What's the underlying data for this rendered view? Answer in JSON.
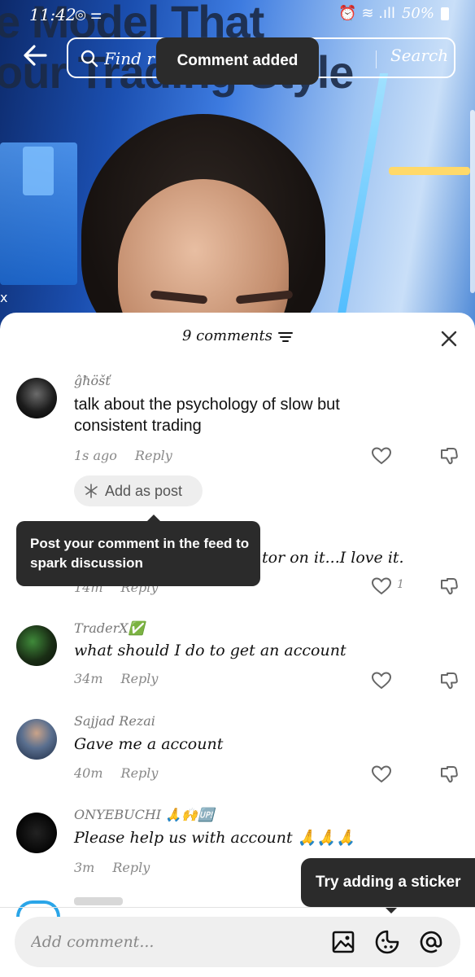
{
  "status_bar": {
    "time": "11:42",
    "left_icons": "◎ ⚌",
    "signal_icons": "⏰ ≋ .ıll",
    "battery": "50%"
  },
  "video": {
    "bg_text_line1": "e Model That",
    "bg_text_line2": "our Trading Style",
    "corner_mark": "x"
  },
  "search": {
    "placeholder": "Find r",
    "button_label": "Search"
  },
  "toast": {
    "text": "Comment added"
  },
  "sheet": {
    "title": "9 comments",
    "comments": [
      {
        "username": "ĝħöšť",
        "text": "talk about the psychology of slow but consistent trading",
        "time": "1s ago",
        "reply_label": "Reply",
        "like_count": ""
      },
      {
        "username": "",
        "text": "tor on it...I love it.",
        "time": "14m",
        "reply_label": "Reply",
        "like_count": "1"
      },
      {
        "username": "TraderX✅",
        "text": "what should I do to get an account",
        "time": "34m",
        "reply_label": "Reply",
        "like_count": ""
      },
      {
        "username": "Sajjad Rezai",
        "text": "Gave me a account",
        "time": "40m",
        "reply_label": "Reply",
        "like_count": ""
      },
      {
        "username": "ONYEBUCHI 🙏🙌🆙",
        "text": "Please help us with account 🙏🙏🙏",
        "time": "3m",
        "reply_label": "Reply",
        "like_count": ""
      }
    ],
    "add_as_post_label": "Add as post",
    "tooltip_text": "Post your comment in the feed to spark discussion"
  },
  "composer": {
    "placeholder": "Add comment...",
    "sticker_tip": "Try adding a sticker"
  },
  "colors": {
    "tooltip_bg": "#2b2b2b",
    "sheet_bg": "#ffffff",
    "composer_bg": "#efefef",
    "meta_text": "#888888"
  },
  "icons": [
    "back-arrow-icon",
    "search-icon",
    "sort-icon",
    "close-icon",
    "heart-icon",
    "dislike-icon",
    "sparkle-icon",
    "image-icon",
    "sticker-icon",
    "mention-icon"
  ]
}
